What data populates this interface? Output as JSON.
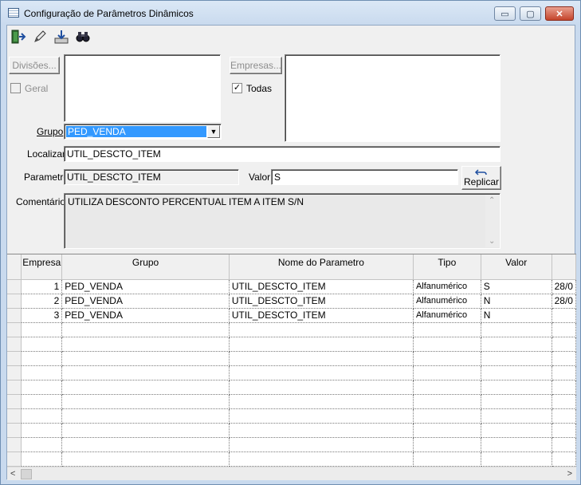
{
  "window": {
    "title": "Configuração de Parâmetros Dinâmicos",
    "controls": {
      "minimize": "▭",
      "maximize": "▢",
      "close": "✕"
    }
  },
  "toolbar": {
    "buttons": [
      {
        "name": "exit-door-icon",
        "tooltip": ""
      },
      {
        "name": "pencil-edit-icon",
        "tooltip": ""
      },
      {
        "name": "download-tray-icon",
        "tooltip": ""
      },
      {
        "name": "binoculars-icon",
        "tooltip": ""
      }
    ]
  },
  "form": {
    "divisoes_button": "Divisões...",
    "geral_label": "Geral",
    "geral_checked": false,
    "empresas_button": "Empresas...",
    "todas_label": "Todas",
    "todas_checked": true,
    "todas_mark": "✓",
    "grupo_label": "Grupo",
    "grupo_value": "PED_VENDA",
    "localizar_label": "Localizar",
    "localizar_value": "UTIL_DESCTO_ITEM",
    "parametro_label": "Parametro",
    "parametro_value": "UTIL_DESCTO_ITEM",
    "valor_label": "Valor",
    "valor_value": "S",
    "replicar_button": "Replicar",
    "comentarios_label": "Comentários",
    "comentarios_value": "UTILIZA DESCONTO PERCENTUAL ITEM A ITEM S/N"
  },
  "grid": {
    "columns": [
      "Empresa",
      "Grupo",
      "Nome do Parametro",
      "Tipo",
      "Valor",
      ""
    ],
    "rows": [
      {
        "empresa": "1",
        "grupo": "PED_VENDA",
        "nome": "UTIL_DESCTO_ITEM",
        "tipo": "Alfanumérico",
        "valor": "S",
        "data": "28/0"
      },
      {
        "empresa": "2",
        "grupo": "PED_VENDA",
        "nome": "UTIL_DESCTO_ITEM",
        "tipo": "Alfanumérico",
        "valor": "N",
        "data": "28/0"
      },
      {
        "empresa": "3",
        "grupo": "PED_VENDA",
        "nome": "UTIL_DESCTO_ITEM",
        "tipo": "Alfanumérico",
        "valor": "N",
        "data": ""
      }
    ]
  },
  "scrollbar": {
    "left_arrow": "<",
    "right_arrow": ">"
  },
  "colors": {
    "selection": "#3399ff",
    "face": "#f0f0f0",
    "titlebar": "#c9daee"
  }
}
